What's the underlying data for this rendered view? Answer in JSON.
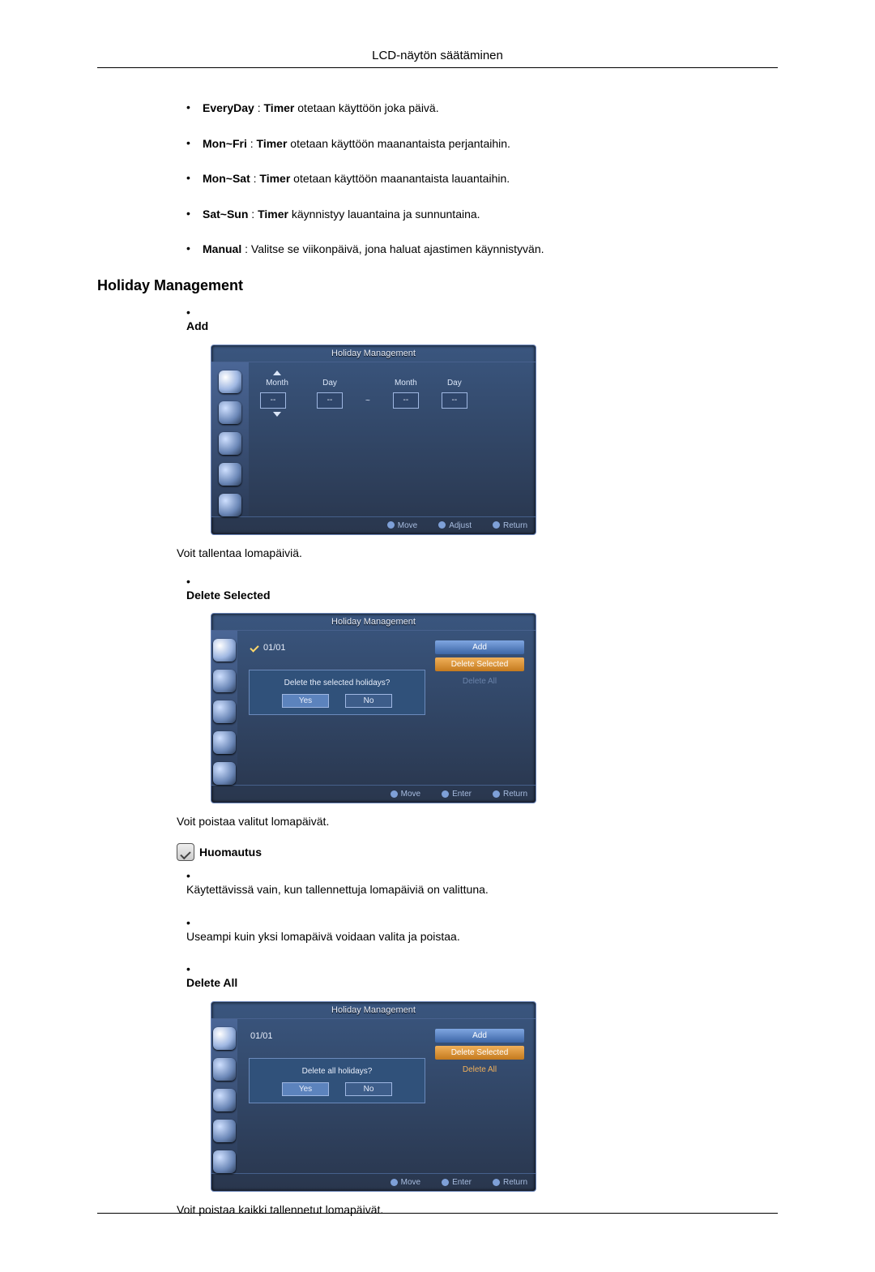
{
  "header": {
    "title": "LCD-näytön säätäminen"
  },
  "timer_list": [
    {
      "label": "EveryDay",
      "sep": " : ",
      "bold2": "Timer",
      "rest": " otetaan käyttöön joka päivä."
    },
    {
      "label": "Mon~Fri",
      "sep": " : ",
      "bold2": "Timer",
      "rest": " otetaan käyttöön maanantaista perjantaihin."
    },
    {
      "label": "Mon~Sat",
      "sep": " : ",
      "bold2": "Timer",
      "rest": " otetaan käyttöön maanantaista lauantaihin."
    },
    {
      "label": "Sat~Sun",
      "sep": " : ",
      "bold2": "Timer",
      "rest": " käynnistyy lauantaina ja sunnuntaina."
    },
    {
      "label": "Manual",
      "sep": " : ",
      "bold2": "",
      "rest": "Valitse se viikonpäivä, jona haluat ajastimen käynnistyvän."
    }
  ],
  "section_title": "Holiday Management",
  "add": {
    "label": "Add",
    "figure": {
      "title": "Holiday Management",
      "col_month": "Month",
      "col_day": "Day",
      "value": "--",
      "footer": {
        "move": "Move",
        "adjust": "Adjust",
        "return": "Return"
      }
    },
    "desc": "Voit tallentaa lomapäiviä."
  },
  "delete_selected": {
    "label": "Delete Selected",
    "figure": {
      "title": "Holiday Management",
      "holiday_date": "01/01",
      "buttons": {
        "add": "Add",
        "delete_selected": "Delete Selected",
        "delete_all": "Delete All"
      },
      "dialog_q": "Delete the selected holidays?",
      "yes": "Yes",
      "no": "No",
      "footer": {
        "move": "Move",
        "enter": "Enter",
        "return": "Return"
      }
    },
    "desc": "Voit poistaa valitut lomapäivät.",
    "note_label": "Huomautus",
    "notes": [
      "Käytettävissä vain, kun tallennettuja lomapäiviä on valittuna.",
      "Useampi kuin yksi lomapäivä voidaan valita ja poistaa."
    ]
  },
  "delete_all": {
    "label": "Delete All",
    "figure": {
      "title": "Holiday Management",
      "holiday_date": "01/01",
      "buttons": {
        "add": "Add",
        "delete_selected": "Delete Selected",
        "delete_all": "Delete All"
      },
      "dialog_q": "Delete all holidays?",
      "yes": "Yes",
      "no": "No",
      "footer": {
        "move": "Move",
        "enter": "Enter",
        "return": "Return"
      }
    },
    "desc": "Voit poistaa kaikki tallennetut lomapäivät."
  }
}
